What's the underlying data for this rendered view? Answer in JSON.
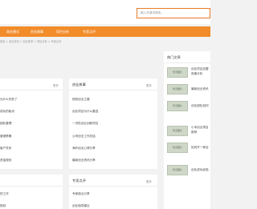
{
  "header": {
    "search_placeholder": "输入关键词搜索..."
  },
  "nav": {
    "items": [
      "商业模式",
      "创业故事",
      "项目分析",
      "专家点评"
    ]
  },
  "breadcrumb": "首页 > 创业资讯 > 创业故事 > 项目分析 > 专家点评",
  "left_panel": {
    "more": "更多",
    "items": [
      "为什么失败了",
      "成功的秘诀",
      "团队管理",
      "营销策略",
      "客户关系",
      "资金规划",
      "品牌建设"
    ]
  },
  "middle_panel": {
    "title": "创业故事",
    "more": "更多",
    "items": [
      "他的创业之路",
      "创业项目为什么要选",
      "一次性创业创新项目",
      "公司创业工作总结",
      "海外创业心得分享",
      "最新创业资讯分享"
    ]
  },
  "right_panel": {
    "title": "热门文章",
    "thumb_label": "暂无图片",
    "items": [
      {
        "line1": "创业项目加盟",
        "line2": "前景分析"
      },
      {
        "line1": "最新创业资讯",
        "line2": ""
      },
      {
        "line1": "创业团队如何",
        "line2": ""
      },
      {
        "line1": "小本创业项目",
        "line2": "推荐"
      },
      {
        "line1": "如何开一家店",
        "line2": ""
      },
      {
        "line1": "创业成功经验",
        "line2": ""
      }
    ]
  },
  "bottom_left": {
    "items": [
      "的工作",
      "规划"
    ]
  },
  "bottom_middle": {
    "title": "专家点评",
    "more": "更多",
    "items": [
      "专家观点分享",
      "创业指导建议"
    ]
  }
}
